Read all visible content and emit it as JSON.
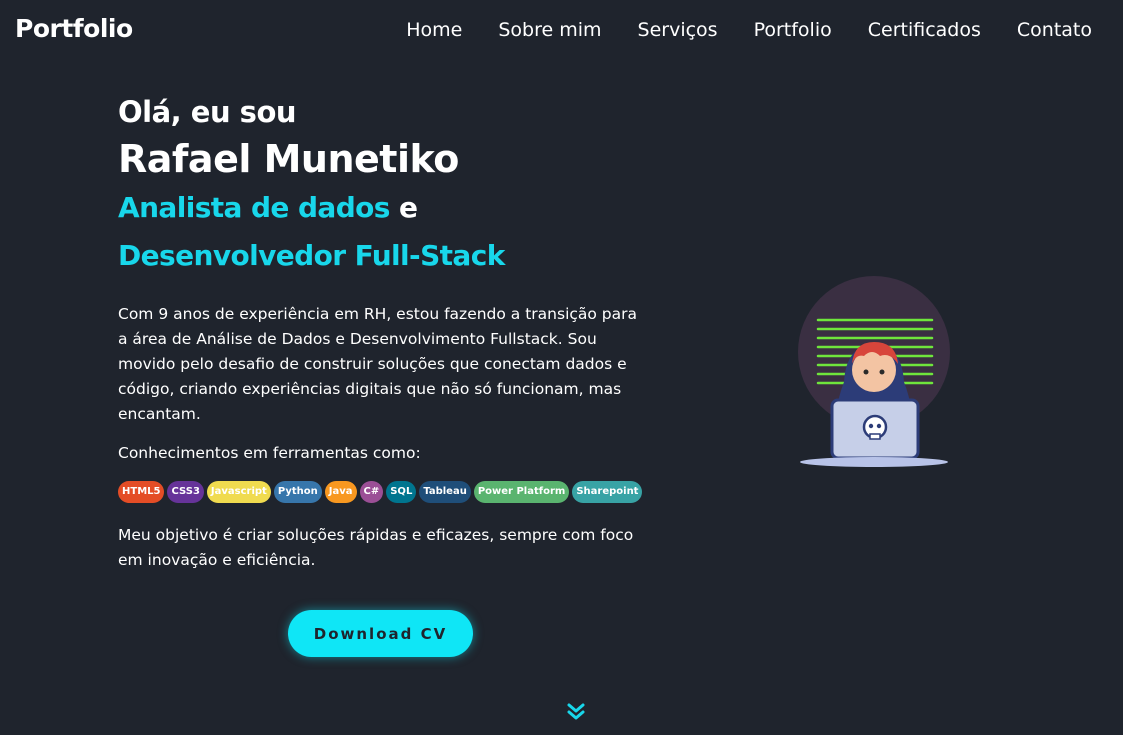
{
  "header": {
    "logo": "Portfolio",
    "nav": [
      "Home",
      "Sobre mim",
      "Serviços",
      "Portfolio",
      "Certificados",
      "Contato"
    ]
  },
  "hero": {
    "greeting": "Olá, eu sou",
    "name": "Rafael Munetiko",
    "role_1": "Analista de dados",
    "role_connector": "e",
    "role_2": "Desenvolvedor Full-Stack",
    "intro": "Com 9 anos de experiência em RH, estou fazendo a transição para a área de Análise de Dados e Desenvolvimento Fullstack. Sou movido pelo desafio de construir soluções que conectam dados e código, criando experiências digitais que não só funcionam, mas encantam.",
    "tools_title": "Conhecimentos em ferramentas como:",
    "tools": [
      {
        "label": "HTML5",
        "color": "#e44d26"
      },
      {
        "label": "CSS3",
        "color": "#663399"
      },
      {
        "label": "Javascript",
        "color": "#f0db4f"
      },
      {
        "label": "Python",
        "color": "#3776ab"
      },
      {
        "label": "Java",
        "color": "#f89820"
      },
      {
        "label": "C#",
        "color": "#9b4f96"
      },
      {
        "label": "SQL",
        "color": "#00758f"
      },
      {
        "label": "Tableau",
        "color": "#1f4e79"
      },
      {
        "label": "Power Platform",
        "color": "#5ab46f"
      },
      {
        "label": "Sharepoint",
        "color": "#38a3a5"
      }
    ],
    "goal": "Meu objetivo é criar soluções rápidas e eficazes, sempre com foco em inovação e eficiência.",
    "cta": "Download CV"
  },
  "icons": {
    "scroll": "chevron-double-down-icon",
    "avatar": "hacker-laptop-illustration"
  },
  "colors": {
    "background": "#1f242d",
    "accent": "#0fe6f6",
    "text": "#ffffff"
  }
}
